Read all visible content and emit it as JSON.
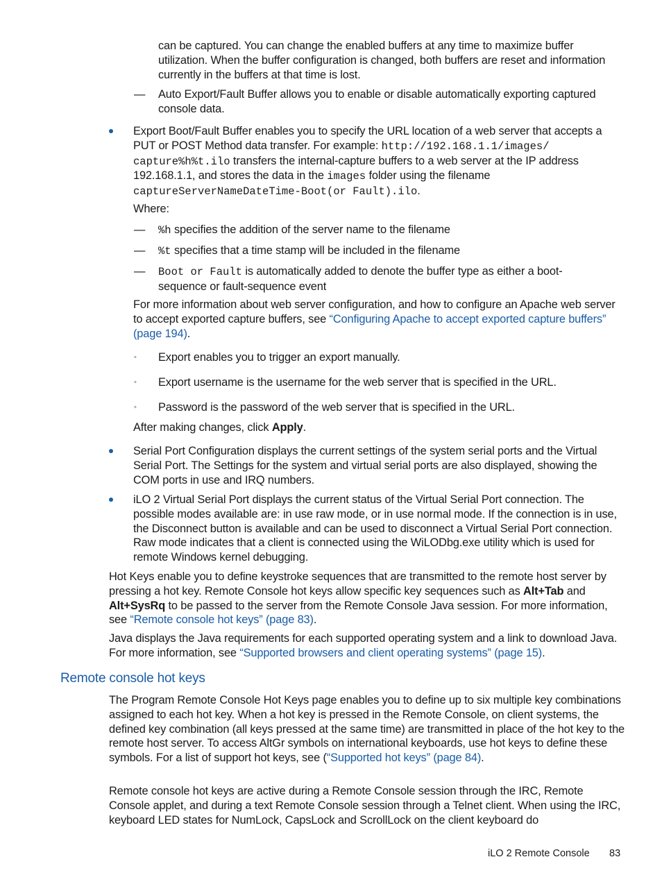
{
  "page": {
    "footer": {
      "section": "iLO 2 Remote Console",
      "page_number": "83"
    },
    "continuation": {
      "text": "can be captured. You can change the enabled buffers at any time to maximize buffer utilization. When the buffer configuration is changed, both buffers are reset and information currently in the buffers at that time is lost."
    },
    "auto_export": {
      "marker": "—",
      "text": "Auto Export/Fault Buffer allows you to enable or disable automatically exporting captured console data."
    },
    "export_buffer": {
      "t1": "Export Boot/Fault Buffer enables you to specify the URL location of a web server that accepts a PUT or POST Method data transfer. For example: ",
      "code1": "http://192.168.1.1/images/ capture%h%t.ilo",
      "t2": " transfers the internal-capture buffers to a web server at the IP address 192.168.1.1, and stores the data in the ",
      "code2": "images",
      "t3": " folder using the filename ",
      "code3": "captureServerNameDateTime-Boot(or Fault).ilo",
      "t4": ".",
      "where": "Where:",
      "items": [
        {
          "marker": "—",
          "code": "%h",
          "text": " specifies the addition of the server name to the filename"
        },
        {
          "marker": "—",
          "code": "%t",
          "text": " specifies that a time stamp will be included in the filename"
        },
        {
          "marker": "—",
          "code": "Boot or Fault",
          "text": " is automatically added to denote the buffer type as either a boot-sequence or fault-sequence event"
        }
      ],
      "more_info_text": "For more information about web server configuration, and how to configure an Apache web server to accept exported capture buffers, see ",
      "more_info_link": "“Configuring Apache to accept exported capture buffers” (page 194)",
      "more_info_end": ".",
      "sub_items": [
        {
          "marker": "◦",
          "text": "Export enables you to trigger an export manually."
        },
        {
          "marker": "◦",
          "text": "Export username is the username for the web server that is specified in the URL."
        },
        {
          "marker": "◦",
          "text": "Password is the password of the web server that is specified in the URL."
        }
      ],
      "after_text": "After making changes, click ",
      "after_bold": "Apply",
      "after_end": "."
    },
    "serial_port": {
      "text": "Serial Port Configuration displays the current settings of the system serial ports and the Virtual Serial Port. The Settings for the system and virtual serial ports are also displayed, showing the COM ports in use and IRQ numbers."
    },
    "virtual_serial": {
      "text": "iLO 2 Virtual Serial Port displays the current status of the Virtual Serial Port connection. The possible modes available are: in use raw mode, or in use normal mode. If the connection is in use, the Disconnect button is available and can be used to disconnect a Virtual Serial Port connection. Raw mode indicates that a client is connected using the WiLODbg.exe utility which is used for remote Windows kernel debugging."
    },
    "hot_keys_para": {
      "t1": "Hot Keys enable you to define keystroke sequences that are transmitted to the remote host server by pressing a hot key. Remote Console hot keys allow specific key sequences such as ",
      "b1": "Alt+Tab",
      "t2": " and ",
      "b2": "Alt+SysRq",
      "t3": " to be passed to the server from the Remote Console Java session. For more information, see ",
      "link": "“Remote console hot keys” (page 83)",
      "end": "."
    },
    "java_para": {
      "t1": "Java displays the Java requirements for each supported operating system and a link to download Java. For more information, see ",
      "link": "“Supported browsers and client operating systems” (page 15)",
      "end": "."
    },
    "section_heading": "Remote console hot keys",
    "section_p1": {
      "t1": "The Program Remote Console Hot Keys page enables you to define up to six multiple key combinations assigned to each hot key. When a hot key is pressed in the Remote Console, on client systems, the defined key combination (all keys pressed at the same time) are transmitted in place of the hot key to the remote host server. To access AltGr symbols on international keyboards, use hot keys to define these symbols. For a list of support hot keys, see (",
      "link": "“Supported hot keys” (page 84)",
      "end": "."
    },
    "section_p2": {
      "text": "Remote console hot keys are active during a Remote Console session through the IRC, Remote Console applet, and during a text Remote Console session through a Telnet client. When using the IRC, keyboard LED states for NumLock, CapsLock and ScrollLock on the client keyboard do"
    }
  }
}
